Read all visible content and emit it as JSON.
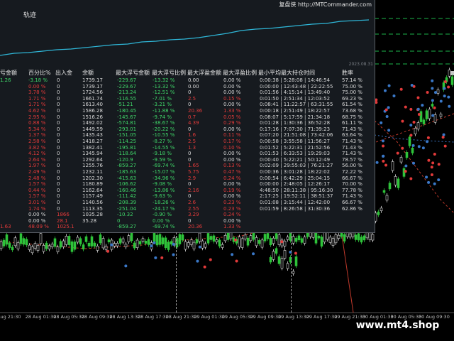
{
  "panel": {
    "title": "轨迹",
    "source": "复盘侠 http://MTCommander.com",
    "equity_date": "2023.08.31"
  },
  "table": {
    "headers": [
      "亏金额",
      "百分比%",
      "出入金",
      "余额",
      "最大浮亏金额",
      "最大浮亏比例",
      "最大浮盈金额",
      "最大浮盈比例",
      "最小平均最大持仓时间",
      "胜率"
    ],
    "rows": [
      {
        "a": "1.26",
        "b": "-3.18 %",
        "c": "0",
        "d": "1739.17",
        "e": "-229.67",
        "f": "-13.32 %",
        "g": "0.00",
        "h": "0.00 %",
        "i": "0:00:38 | 5:28:08 | 14:46:54",
        "j": "57.14 %",
        "ca": "green",
        "cb": "green",
        "cc": "white",
        "cg": "white",
        "ch": "white"
      },
      {
        "a": "",
        "b": "0.00 %",
        "c": "0",
        "d": "1739.17",
        "e": "-229.67",
        "f": "-13.32 %",
        "g": "0.00",
        "h": "0.00 %",
        "i": "0:00:00 | 12:43:48 | 22:22:55",
        "j": "75.00 %",
        "ca": "red",
        "cb": "red",
        "cc": "white",
        "cg": "white",
        "ch": "white"
      },
      {
        "a": "",
        "b": "3.78 %",
        "c": "0",
        "d": "1724.56",
        "e": "-213.24",
        "f": "-12.51 %",
        "g": "0",
        "h": "0.00 %",
        "i": "0:01:56 | 4:15:14 | 13:49:40",
        "j": "75.00 %",
        "ca": "red",
        "cb": "red",
        "cc": "white",
        "cg": "white",
        "ch": "white"
      },
      {
        "a": "",
        "b": "1.71 %",
        "c": "0",
        "d": "1661.74",
        "e": "-116.55",
        "f": "-7.01 %",
        "g": "2.5",
        "h": "0.15 %",
        "i": "0:01:50 | 2:51:34 | 12:03:52",
        "j": "69.23 %",
        "ca": "red",
        "cb": "red",
        "cc": "white",
        "cg": "red",
        "ch": "red"
      },
      {
        "a": "",
        "b": "1.71 %",
        "c": "0",
        "d": "1613.40",
        "e": "-51.21",
        "f": "-3.21 %",
        "g": "0",
        "h": "0.00 %",
        "i": "0:08:41 | 11:22:57 | 63:31:55",
        "j": "61.54 %",
        "ca": "red",
        "cb": "red",
        "cc": "white",
        "cg": "white",
        "ch": "white"
      },
      {
        "a": "",
        "b": "4.62 %",
        "c": "0",
        "d": "1586.28",
        "e": "-180.45",
        "f": "-11.88 %",
        "g": "20.36",
        "h": "1.33 %",
        "i": "0:00:18 | 2:51:49 | 18:22:57",
        "j": "73.68 %",
        "ca": "red",
        "cb": "red",
        "cc": "white",
        "cg": "red",
        "ch": "red"
      },
      {
        "a": "",
        "b": "2.95 %",
        "c": "0",
        "d": "1516.26",
        "e": "-145.67",
        "f": "-9.74 %",
        "g": "0.7",
        "h": "0.05 %",
        "i": "0:08:07 | 5:17:59 | 21:34:18",
        "j": "68.75 %",
        "ca": "red",
        "cb": "red",
        "cc": "white",
        "cg": "red",
        "ch": "red"
      },
      {
        "a": "",
        "b": "0.88 %",
        "c": "0",
        "d": "1492.02",
        "e": "-574.81",
        "f": "-38.67 %",
        "g": "4.39",
        "h": "0.29 %",
        "i": "0:01:28 | 1:30:36 | 36:52:28",
        "j": "61.11 %",
        "ca": "red",
        "cb": "red",
        "cc": "white",
        "cg": "red",
        "ch": "red"
      },
      {
        "a": "",
        "b": "5.34 %",
        "c": "0",
        "d": "1449.59",
        "e": "-293.01",
        "f": "-20.22 %",
        "g": "0",
        "h": "0.00 %",
        "i": "0:17:16 | 7:07:30 | 71:39:23",
        "j": "71.43 %",
        "ca": "red",
        "cb": "red",
        "cc": "white",
        "cg": "white",
        "ch": "white"
      },
      {
        "a": "",
        "b": "1.37 %",
        "c": "0",
        "d": "1435.43",
        "e": "-151.05",
        "f": "-10.55 %",
        "g": "1.6",
        "h": "0.11 %",
        "i": "0:07:20 | 21:51:08 | 73:42:06",
        "j": "63.64 %",
        "ca": "red",
        "cb": "red",
        "cc": "white",
        "cg": "red",
        "ch": "red"
      },
      {
        "a": "",
        "b": "2.58 %",
        "c": "0",
        "d": "1418.27",
        "e": "-114.25",
        "f": "-8.27 %",
        "g": "2.5",
        "h": "0.17 %",
        "i": "0:00:58 | 3:55:58 | 11:56:27",
        "j": "71.43 %",
        "ca": "red",
        "cb": "red",
        "cc": "white",
        "cg": "red",
        "ch": "red"
      },
      {
        "a": "",
        "b": "3.82 %",
        "c": "0",
        "d": "1382.41",
        "e": "-195.81",
        "f": "-14.55 %",
        "g": "1.3",
        "h": "0.10 %",
        "i": "0:01:52 | 5:22:31 | 21:52:56",
        "j": "71.43 %",
        "ca": "red",
        "cb": "red",
        "cc": "white",
        "cg": "red",
        "ch": "red"
      },
      {
        "a": "",
        "b": "4.12 %",
        "c": "0",
        "d": "1345.94",
        "e": "-118.64",
        "f": "-9.18 %",
        "g": "0",
        "h": "0.00 %",
        "i": "0:01:53 | 6:33:53 | 19:29:03",
        "j": "71.43 %",
        "ca": "red",
        "cb": "red",
        "cc": "white",
        "cg": "white",
        "ch": "white"
      },
      {
        "a": "",
        "b": "2.64 %",
        "c": "0",
        "d": "1292.64",
        "e": "-120.9",
        "f": "-9.59 %",
        "g": "0",
        "h": "0.00 %",
        "i": "0:00:40 | 5:22:21 | 50:12:49",
        "j": "78.57 %",
        "ca": "red",
        "cb": "red",
        "cc": "white",
        "cg": "white",
        "ch": "white"
      },
      {
        "a": "",
        "b": "1.97 %",
        "c": "0",
        "d": "1255.76",
        "e": "-859.27",
        "f": "-69.74 %",
        "g": "1.65",
        "h": "0.13 %",
        "i": "0:02:09 | 29:55:03 | 76:21:27",
        "j": "56.00 %",
        "ca": "red",
        "cb": "red",
        "cc": "white",
        "cg": "red",
        "ch": "red"
      },
      {
        "a": "",
        "b": "2.49 %",
        "c": "0",
        "d": "1232.11",
        "e": "-185.63",
        "f": "-15.07 %",
        "g": "5.75",
        "h": "0.47 %",
        "i": "0:00:36 | 3:01:28 | 18:22:02",
        "j": "72.22 %",
        "ca": "red",
        "cb": "red",
        "cc": "white",
        "cg": "red",
        "ch": "red"
      },
      {
        "a": "",
        "b": "2.48 %",
        "c": "0",
        "d": "1202.30",
        "e": "-415.63",
        "f": "-34.96 %",
        "g": "2.9",
        "h": "0.24 %",
        "i": "0:00:54 | 6:42:29 | 25:04:15",
        "j": "66.67 %",
        "ca": "red",
        "cb": "red",
        "cc": "white",
        "cg": "red",
        "ch": "red"
      },
      {
        "a": "",
        "b": "1.57 %",
        "c": "0",
        "d": "1180.89",
        "e": "-106.62",
        "f": "-9.08 %",
        "g": "0",
        "h": "0.00 %",
        "i": "0:00:00 | 2:48:05 | 12:26:17",
        "j": "70.00 %",
        "ca": "red",
        "cb": "red",
        "cc": "white",
        "cg": "white",
        "ch": "white"
      },
      {
        "a": "",
        "b": "0.44 %",
        "c": "0",
        "d": "1162.64",
        "e": "-160.46",
        "f": "-13.86 %",
        "g": "2.16",
        "h": "0.19 %",
        "i": "4:48:50 | 28:11:38 | 95:16:30",
        "j": "77.78 %",
        "ca": "red",
        "cb": "red",
        "cc": "white",
        "cg": "red",
        "ch": "red"
      },
      {
        "a": "",
        "b": "1.57 %",
        "c": "0",
        "d": "1157.49",
        "e": "-111.42",
        "f": "-9.63 %",
        "g": "0",
        "h": "0.00 %",
        "i": "2:17:25 | 19:52:11 | 38:51:37",
        "j": "71.43 %",
        "ca": "red",
        "cb": "red",
        "cc": "white",
        "cg": "white",
        "ch": "white"
      },
      {
        "a": "",
        "b": "3.01 %",
        "c": "0",
        "d": "1140.56",
        "e": "-208.39",
        "f": "-18.26 %",
        "g": "2.6",
        "h": "0.23 %",
        "i": "0:01:08 | 3:15:44 | 12:42:00",
        "j": "66.67 %",
        "ca": "red",
        "cb": "red",
        "cc": "white",
        "cg": "red",
        "ch": "red"
      },
      {
        "a": "",
        "b": "1.74 %",
        "c": "0",
        "d": "1113.35",
        "e": "-251.04",
        "f": "-24.17 %",
        "g": "2.55",
        "h": "0.23 %",
        "i": "0:01:59 | 8:26:58 | 31:30:36",
        "j": "62.86 %",
        "ca": "red",
        "cb": "red",
        "cc": "white",
        "cg": "red",
        "ch": "red"
      },
      {
        "a": "",
        "b": "0.00 %",
        "c": "1866",
        "d": "1035.28",
        "e": "-10.32",
        "f": "-0.90 %",
        "g": "3.29",
        "h": "0.24 %",
        "i": "",
        "j": "",
        "ca": "red",
        "cb": "white",
        "cc": "red",
        "cg": "red",
        "ch": "red"
      },
      {
        "a": "",
        "b": "0.00 %",
        "c": "28.1",
        "d": "35.28",
        "e": "0",
        "f": "0.00 %",
        "g": "0",
        "h": "0.00 %",
        "i": "",
        "j": "",
        "ca": "red",
        "cb": "white",
        "cc": "red",
        "cg": "white",
        "ch": "white"
      },
      {
        "a": "1.63",
        "b": "48.09 %",
        "c": "1025.1",
        "d": "",
        "e": "-859.27",
        "f": "-69.74 %",
        "g": "20.36",
        "h": "1.33 %",
        "i": "",
        "j": "",
        "ca": "red",
        "cb": "red",
        "cc": "red",
        "cg": "red",
        "ch": "red"
      }
    ]
  },
  "xaxis": {
    "ticks": [
      "Aug 21:30",
      "28 Aug 01:30",
      "28 Aug 05:30",
      "28 Aug 09:30",
      "28 Aug 13:30",
      "28 Aug 17:30",
      "28 Aug 21:30",
      "29 Aug 01:30",
      "29 Aug 05:30",
      "29 Aug 09:30",
      "29 Aug 13:30",
      "29 Aug 17:30",
      "29 Aug 21:30",
      "30 Aug 01:30",
      "30 Aug 05:30",
      "30 Aug 09:30"
    ]
  },
  "watermark": "www.mt4.shop",
  "colors": {
    "panel_bg": "#161a1f",
    "equity_line": "#2fb7d8",
    "bull": "#2fc33a",
    "bear": "#ffffff",
    "ma_red": "#c0392b",
    "grid_green": "#1db34a"
  }
}
